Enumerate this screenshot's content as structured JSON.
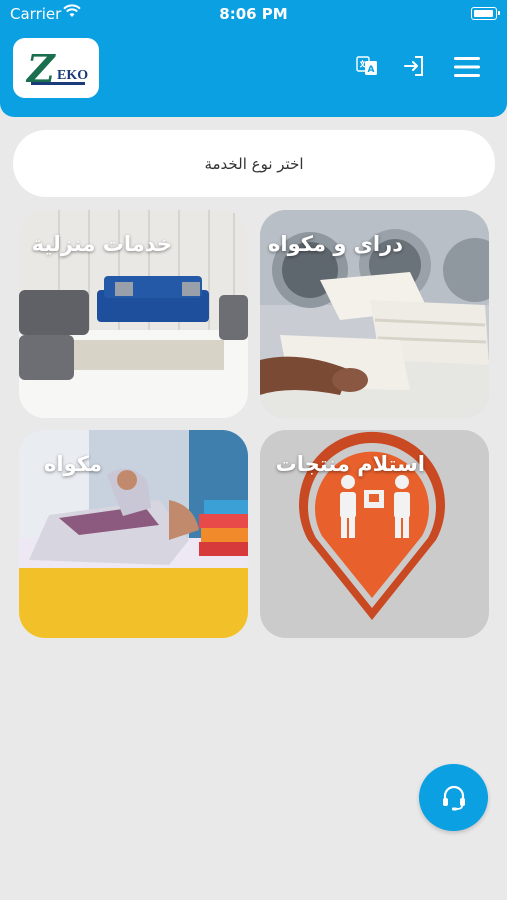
{
  "status_bar": {
    "carrier": "Carrier",
    "time": "8:06 PM"
  },
  "header": {
    "logo_letter": "Z",
    "logo_text": "EKO",
    "accent": "#0aa0e2"
  },
  "selector": {
    "text": "اختر نوع الخدمة"
  },
  "services": [
    {
      "label": "دراى و مكواه",
      "icon": "laundry-folding-image"
    },
    {
      "label": "خدمات منزلية",
      "icon": "living-room-sofa-image"
    },
    {
      "label": "استلام منتجات",
      "icon": "delivery-pin-image"
    },
    {
      "label": "مكواه",
      "icon": "ironing-image"
    }
  ],
  "support": {
    "icon": "headset-icon"
  }
}
